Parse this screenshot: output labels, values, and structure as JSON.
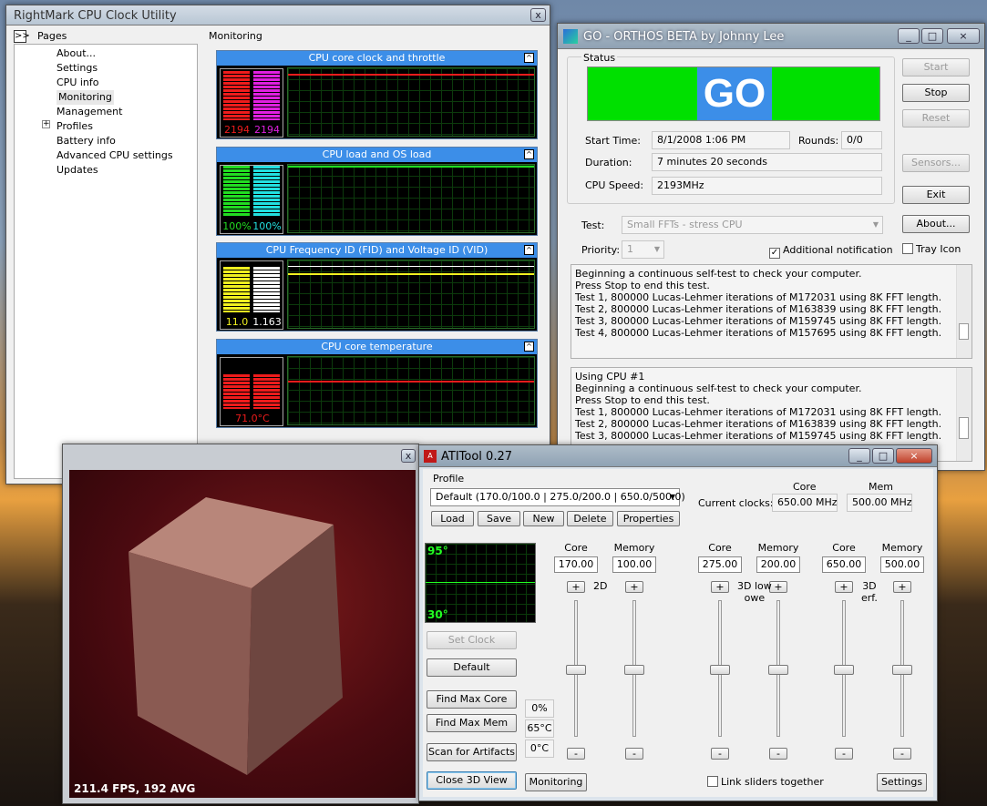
{
  "rightmark": {
    "title": "RightMark CPU Clock Utility",
    "close": "x",
    "expand": ">>",
    "pages_label": "Pages",
    "section": "Monitoring",
    "pages": [
      "About...",
      "Settings",
      "CPU info",
      "Monitoring",
      "Management",
      "Profiles",
      "Battery info",
      "Advanced CPU settings",
      "Updates"
    ],
    "panels": [
      {
        "title": "CPU core clock and throttle",
        "values": [
          "2194",
          "2194"
        ],
        "colors": [
          "#ee1c1c",
          "#e020e0"
        ]
      },
      {
        "title": "CPU load and OS load",
        "values": [
          "100%",
          "100%"
        ],
        "colors": [
          "#22dd22",
          "#22e0e0"
        ]
      },
      {
        "title": "CPU Frequency ID (FID) and Voltage ID (VID)",
        "values": [
          "11.0",
          "1.163"
        ],
        "colors": [
          "#f0f020",
          "#ffffff"
        ]
      },
      {
        "title": "CPU core temperature",
        "values": [
          "71.0°C"
        ],
        "colors": [
          "#ee1c1c"
        ]
      }
    ]
  },
  "orthos": {
    "title": "GO - ORTHOS BETA by Johnny Lee",
    "status_label": "Status",
    "go": "GO",
    "start_time_label": "Start Time:",
    "start_time": "8/1/2008 1:06 PM",
    "rounds_label": "Rounds:",
    "rounds": "0/0",
    "duration_label": "Duration:",
    "duration": "7 minutes 20 seconds",
    "cpu_speed_label": "CPU Speed:",
    "cpu_speed": "2193MHz",
    "test_label": "Test:",
    "test_value": "Small FFTs - stress CPU",
    "priority_label": "Priority:",
    "priority_value": "1",
    "notification_label": "Additional notification",
    "notification_checked": "✓",
    "tray_label": "Tray Icon",
    "buttons": {
      "start": "Start",
      "stop": "Stop",
      "reset": "Reset",
      "sensors": "Sensors...",
      "exit": "Exit",
      "about": "About..."
    },
    "log1": [
      "Beginning a continuous self-test to check your computer.",
      "Press Stop to end this test.",
      "Test 1, 800000 Lucas-Lehmer iterations of M172031 using 8K FFT length.",
      "Test 2, 800000 Lucas-Lehmer iterations of M163839 using 8K FFT length.",
      "Test 3, 800000 Lucas-Lehmer iterations of M159745 using 8K FFT length.",
      "Test 4, 800000 Lucas-Lehmer iterations of M157695 using 8K FFT length."
    ],
    "log2": [
      "Using CPU #1",
      "Beginning a continuous self-test to check your computer.",
      "Press Stop to end this test.",
      "Test 1, 800000 Lucas-Lehmer iterations of M172031 using 8K FFT length.",
      "Test 2, 800000 Lucas-Lehmer iterations of M163839 using 8K FFT length.",
      "Test 3, 800000 Lucas-Lehmer iterations of M159745 using 8K FFT length."
    ]
  },
  "render3d": {
    "fps": "211.4 FPS, 192 AVG",
    "close": "x"
  },
  "atitool": {
    "title": "ATITool 0.27",
    "profile_label": "Profile",
    "profile_value": "Default (170.0/100.0 | 275.0/200.0 | 650.0/500.0)",
    "profile_buttons": [
      "Load",
      "Save",
      "New",
      "Delete",
      "Properties"
    ],
    "clocks_label": "Current clocks:",
    "core_label": "Core",
    "mem_label": "Mem",
    "core_clock": "650.00 MHz",
    "mem_clock": "500.00 MHz",
    "temp_hi": "95°",
    "temp_lo": "30°",
    "buttons": {
      "set_clock": "Set Clock",
      "default": "Default",
      "find_max_core": "Find Max Core",
      "find_max_mem": "Find Max Mem",
      "scan": "Scan for Artifacts",
      "close3d": "Close 3D View",
      "monitoring": "Monitoring",
      "settings": "Settings"
    },
    "readouts": [
      "0%",
      "65°C",
      "0°C"
    ],
    "groups": [
      {
        "label": "2D",
        "core_label": "Core",
        "mem_label": "Memory",
        "core": "170.00",
        "mem": "100.00"
      },
      {
        "label": "3D low\nowe",
        "core_label": "Core",
        "mem_label": "Memory",
        "core": "275.00",
        "mem": "200.00"
      },
      {
        "label": "3D\nerf.",
        "core_label": "Core",
        "mem_label": "Memory",
        "core": "650.00",
        "mem": "500.00"
      }
    ],
    "plus": "+",
    "minus": "-",
    "link_label": "Link sliders together"
  }
}
